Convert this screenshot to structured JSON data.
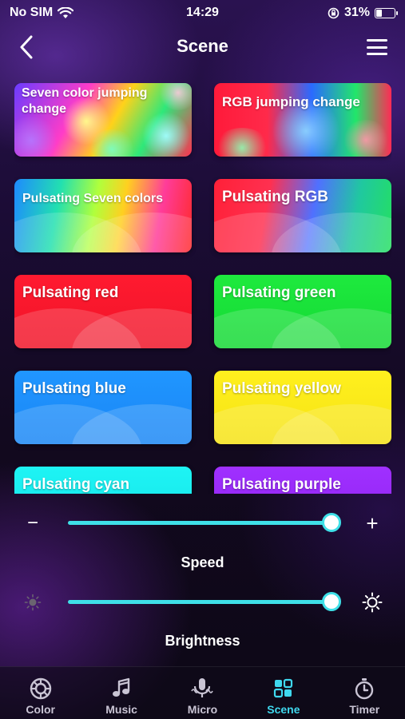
{
  "status": {
    "carrier": "No SIM",
    "time": "14:29",
    "battery": "31%",
    "battery_level": 0.31
  },
  "header": {
    "title": "Scene"
  },
  "scenes": [
    {
      "label": "Seven color jumping change"
    },
    {
      "label": "RGB jumping change"
    },
    {
      "label": "Pulsating Seven colors"
    },
    {
      "label": "Pulsating RGB"
    },
    {
      "label": "Pulsating red"
    },
    {
      "label": "Pulsating green"
    },
    {
      "label": "Pulsating blue"
    },
    {
      "label": "Pulsating yellow"
    },
    {
      "label": "Pulsating cyan"
    },
    {
      "label": "Pulsating purple"
    }
  ],
  "speed": {
    "label": "Speed",
    "minus": "−",
    "plus": "+",
    "value": 1.0
  },
  "brightness": {
    "label": "Brightness",
    "value": 1.0
  },
  "tabs": [
    {
      "label": "Color",
      "icon": "color-wheel-icon"
    },
    {
      "label": "Music",
      "icon": "music-note-icon"
    },
    {
      "label": "Micro",
      "icon": "microphone-icon"
    },
    {
      "label": "Scene",
      "icon": "scene-grid-icon",
      "active": true
    },
    {
      "label": "Timer",
      "icon": "timer-icon"
    }
  ],
  "colors": {
    "accent": "#3fd8ee",
    "red": "#ff1a2e",
    "green": "#19e63a",
    "blue": "#1e90ff",
    "yellow": "#ffee1a",
    "cyan": "#19f0f0",
    "purple": "#9a2bf5"
  }
}
